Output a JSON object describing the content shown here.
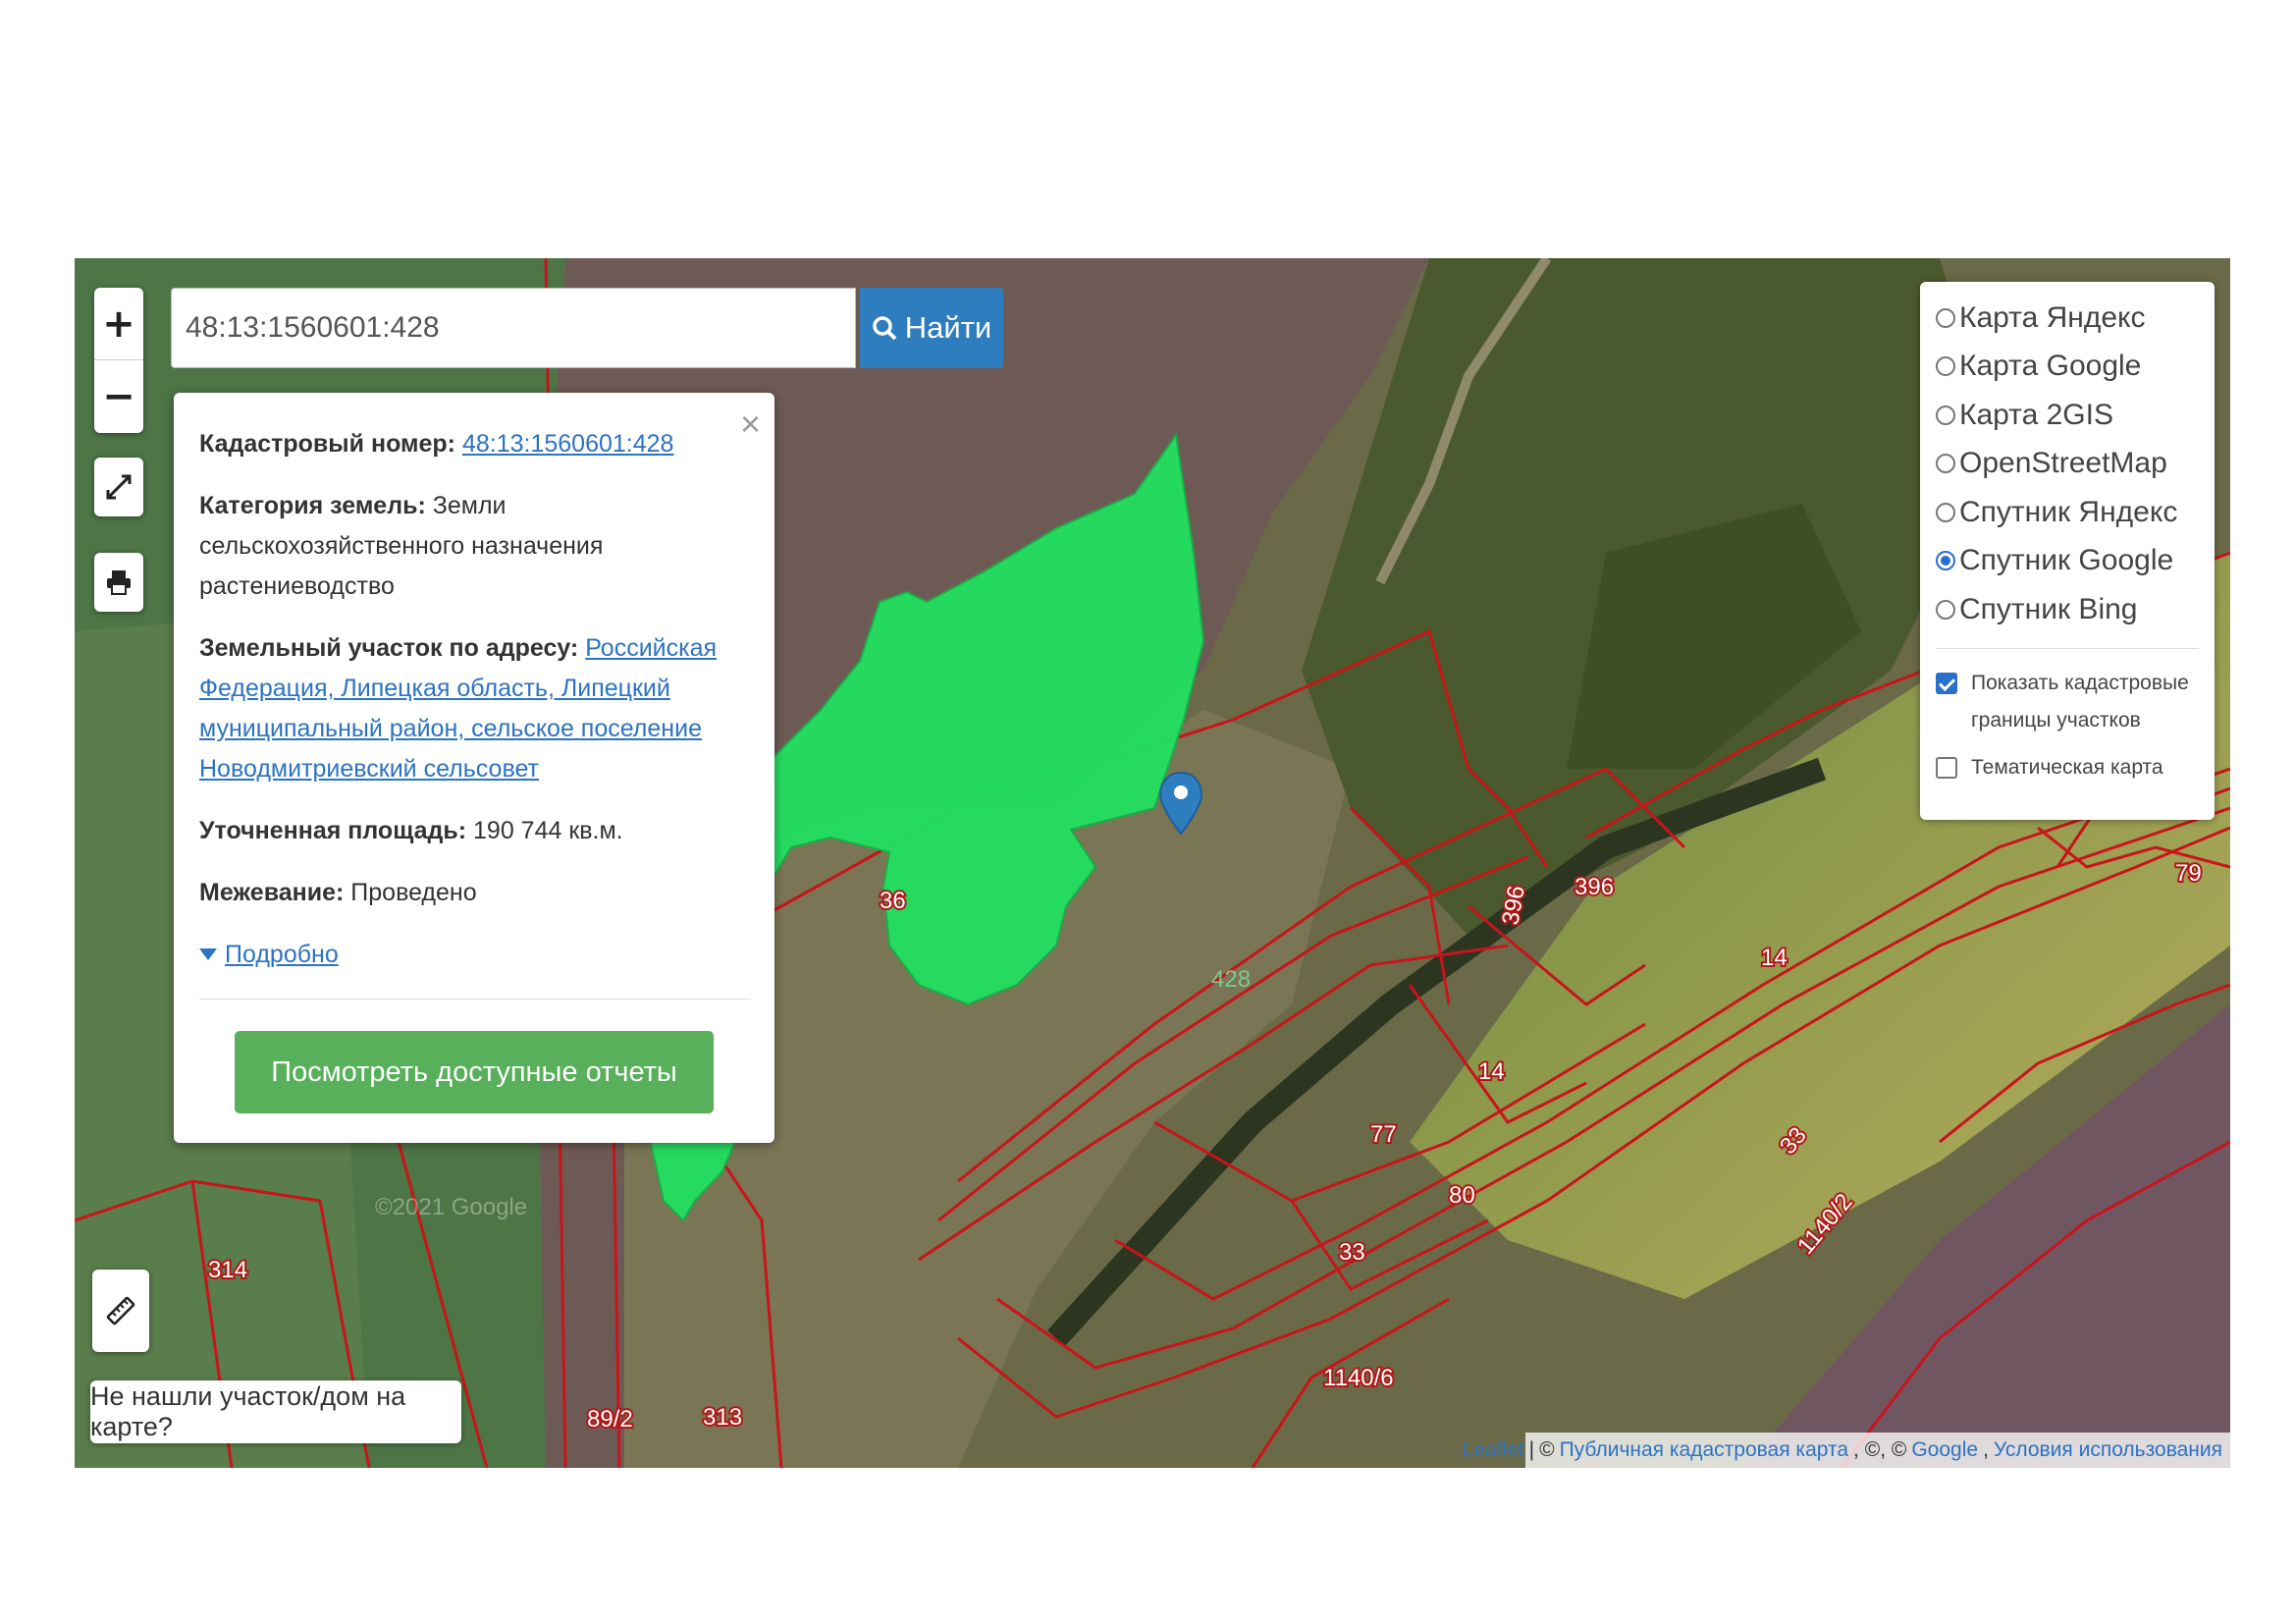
{
  "search": {
    "value": "48:13:1560601:428",
    "button_label": "Найти"
  },
  "zoom": {
    "in_label": "+",
    "out_label": "−"
  },
  "icons": {
    "fullscreen": "expand-icon",
    "print": "print-icon",
    "search": "search-icon",
    "ruler": "ruler-icon",
    "close": "close-icon",
    "marker": "map-marker-icon",
    "caret": "caret-down-icon"
  },
  "popup": {
    "close_label": "×",
    "cadastral_label": "Кадастровый номер:",
    "cadastral_value": "48:13:1560601:428",
    "category_label": "Категория земель:",
    "category_value": "Земли сельскохозяйственного назначения",
    "category_use": "растениеводство",
    "address_label": "Земельный участок по адресу:",
    "address_value": "Российская Федерация, Липецкая область, Липецкий муниципальный район, сельское поселение Новодмитриевский сельсовет",
    "area_label": "Уточненная площадь:",
    "area_value": "190 744 кв.м.",
    "survey_label": "Межевание:",
    "survey_value": "Проведено",
    "more_label": "Подробно",
    "reports_button": "Посмотреть доступные отчеты"
  },
  "layers": {
    "options": [
      {
        "label": "Карта Яндекс",
        "selected": false
      },
      {
        "label": "Карта Google",
        "selected": false
      },
      {
        "label": "Карта 2GIS",
        "selected": false
      },
      {
        "label": "OpenStreetMap",
        "selected": false
      },
      {
        "label": "Спутник Яндекс",
        "selected": false
      },
      {
        "label": "Спутник Google",
        "selected": true
      },
      {
        "label": "Спутник Bing",
        "selected": false
      }
    ],
    "show_boundaries_label": "Показать кадастровые границы участков",
    "show_boundaries_checked": true,
    "thematic_label": "Тематическая карта",
    "thematic_checked": false
  },
  "not_found_label": "Не нашли участок/дом на карте?",
  "attribution": {
    "leaflet": "Leaflet",
    "sep": "|",
    "copy1": "©",
    "cadastral_map": "Публичная кадастровая карта",
    "copy2": ", ©, ©",
    "google": "Google",
    "comma": ",",
    "terms": "Условия использования"
  },
  "parcel_labels": [
    "36",
    "396",
    "396",
    "14",
    "14",
    "79",
    "428",
    "77",
    "80",
    "33",
    "33",
    "1140/2",
    "1140/6",
    "314",
    "313",
    "89/2"
  ],
  "watermark": "©2021 Google",
  "colors": {
    "parcel_fill": "#22e060",
    "boundary": "#c8141a",
    "accent": "#2e7dbf",
    "reports_button": "#58b05b"
  }
}
